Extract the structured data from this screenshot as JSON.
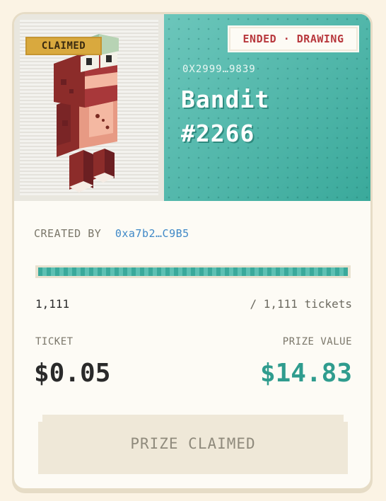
{
  "nft": {
    "badge": "CLAIMED",
    "status": "ENDED · DRAWING",
    "contract": "0X2999…9839",
    "name_line1": "Bandit",
    "name_line2": "#2266"
  },
  "creator": {
    "label": "CREATED BY",
    "address": "0xa7b2…C9B5"
  },
  "tickets": {
    "sold": "1,111",
    "total_text": "/ 1,111 tickets",
    "progress": 1.0
  },
  "ticket": {
    "label": "TICKET",
    "price": "$0.05"
  },
  "prize": {
    "label": "PRIZE VALUE",
    "value": "$14.83"
  },
  "action": {
    "label": "PRIZE CLAIMED"
  },
  "icons": {
    "character": "pixel-frog-character-art"
  },
  "colors": {
    "teal": "#3aa99b",
    "status_red": "#b8383d",
    "badge_gold": "#d9a93e",
    "link_blue": "#3f88c7"
  }
}
